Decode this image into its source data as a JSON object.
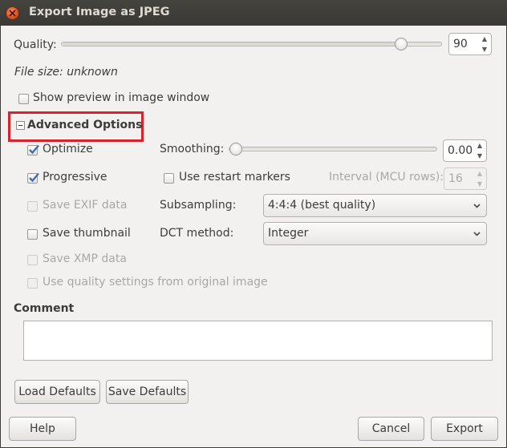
{
  "window": {
    "title": "Export Image as JPEG"
  },
  "quality": {
    "label": "Quality:",
    "value": "90",
    "fraction": 0.9
  },
  "file_size": {
    "text": "File size: unknown"
  },
  "preview": {
    "label": "Show preview in image window",
    "checked": false
  },
  "advanced": {
    "label": "Advanced Options",
    "expanded": true
  },
  "options": {
    "optimize": {
      "label": "Optimize",
      "checked": true
    },
    "progressive": {
      "label": "Progressive",
      "checked": true
    },
    "save_exif": {
      "label": "Save EXIF data",
      "checked": false,
      "enabled": false
    },
    "save_thumbnail": {
      "label": "Save thumbnail",
      "checked": false
    },
    "save_xmp": {
      "label": "Save XMP data",
      "checked": false,
      "enabled": false
    },
    "use_quality": {
      "label": "Use quality settings from original image",
      "checked": false,
      "enabled": false
    }
  },
  "smoothing": {
    "label": "Smoothing:",
    "value": "0.00",
    "fraction": 0.0
  },
  "restart_markers": {
    "label": "Use restart markers",
    "checked": false
  },
  "interval": {
    "label": "Interval (MCU rows):",
    "value": "16",
    "enabled": false
  },
  "subsampling": {
    "label": "Subsampling:",
    "value": "4:4:4 (best quality)"
  },
  "dct": {
    "label": "DCT method:",
    "value": "Integer"
  },
  "comment": {
    "label": "Comment",
    "value": ""
  },
  "buttons": {
    "load_defaults": "Load Defaults",
    "save_defaults": "Save Defaults",
    "help": "Help",
    "cancel": "Cancel",
    "export": "Export"
  },
  "colors": {
    "highlight": "#d5242b",
    "check": "#3c6fb6",
    "close": "#e2521e"
  }
}
